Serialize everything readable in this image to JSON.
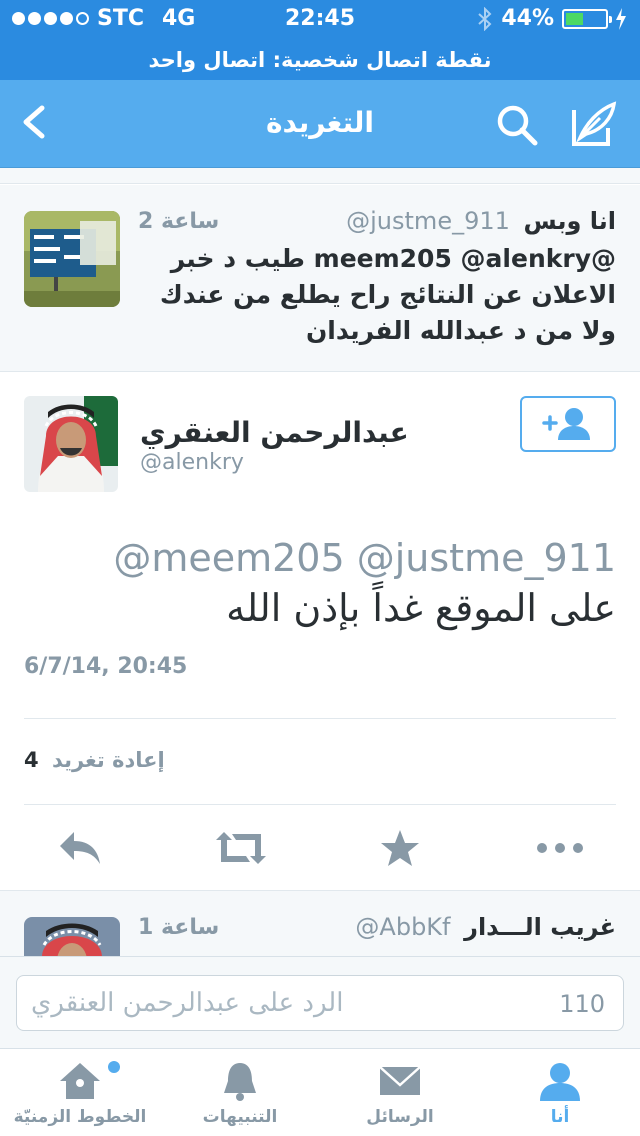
{
  "status_bar": {
    "carrier": "STC",
    "network": "4G",
    "time": "22:45",
    "battery": "44%",
    "battery_level": 0.44,
    "hotspot": "نقطة اتصال شخصية: اتصال واحد"
  },
  "nav": {
    "title": "التغريدة",
    "back_icon": "chevron-left-icon",
    "search_icon": "search-icon",
    "compose_icon": "compose-icon"
  },
  "parent_tweet": {
    "name": "انا وبس",
    "handle": "@justme_911",
    "time": "2 ساعة",
    "text": "@meem205 @alenkry طيب د خبر الاعلان عن النتائج راح يطلع من عندك ولا من د عبدالله الفريدان"
  },
  "main_tweet": {
    "name": "عبدالرحمن العنقري",
    "handle": "@alenkry",
    "mentions": "@meem205 @justme_911",
    "text": "على الموقع غداً بإذن الله",
    "date": "6/7/14, 20:45",
    "retweet_count": "4",
    "retweet_label": "إعادة تغريد"
  },
  "next_tweet": {
    "name": "غريب الـــدار",
    "handle": "@AbbKf",
    "time": "1 ساعة"
  },
  "reply": {
    "placeholder": "الرد على عبدالرحمن العنقري",
    "counter": "110"
  },
  "tabs": [
    {
      "label": "الخطوط الزمنيّة",
      "icon": "home-icon"
    },
    {
      "label": "التنبيهات",
      "icon": "bell-icon"
    },
    {
      "label": "الرسائل",
      "icon": "envelope-icon"
    },
    {
      "label": "أنا",
      "icon": "person-icon"
    }
  ],
  "colors": {
    "status_blue": "#2b8be0",
    "nav_blue": "#55acee",
    "gray_text": "#8899a6"
  }
}
